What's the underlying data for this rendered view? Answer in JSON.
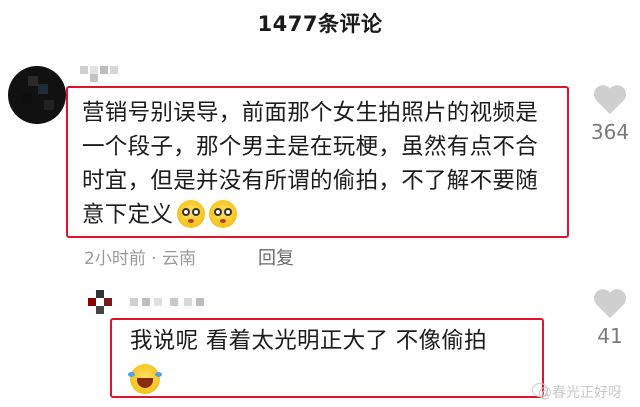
{
  "header": {
    "title": "1477条评论"
  },
  "comments": [
    {
      "text": "营销号别误导，前面那个女生拍照片的视频是一个段子，那个男主是在玩梗，虽然有点不合时宜，但是并没有所谓的偷拍，不了解不要随意下定义",
      "emoji_names": [
        "flushed-face-emoji",
        "flushed-face-emoji"
      ],
      "meta": "2小时前 · 云南",
      "reply_label": "回复",
      "likes": "364"
    }
  ],
  "reply": {
    "text": "我说呢 看着太光明正大了 不像偷拍",
    "emoji_name": "rolling-laughing-emoji",
    "likes": "41"
  },
  "watermark": "@春光正好呀",
  "colors": {
    "highlight_border": "#e3122a",
    "meta_text": "#9a9a9a",
    "heart": "#cfcfcf"
  }
}
